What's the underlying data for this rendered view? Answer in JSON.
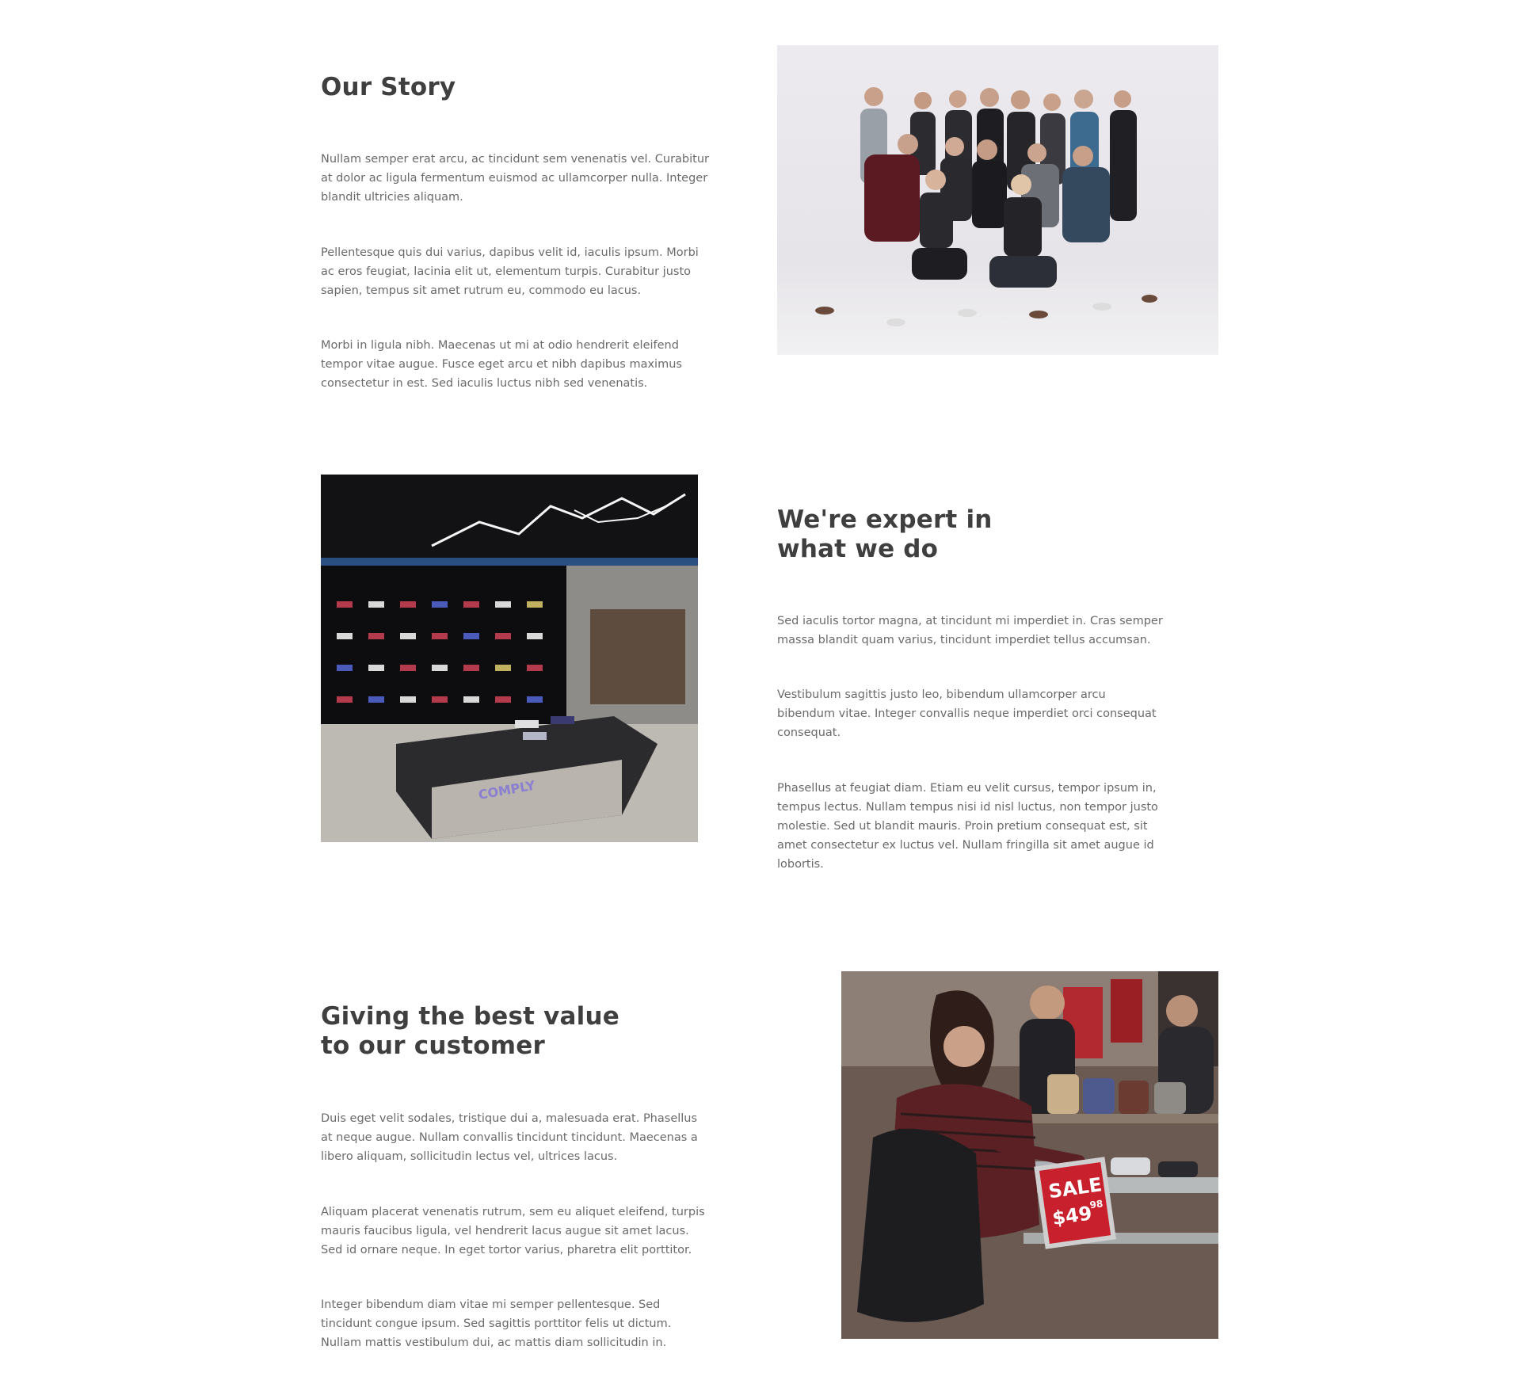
{
  "sections": [
    {
      "title": "Our Story",
      "paragraphs": [
        "Nullam semper erat arcu, ac tincidunt sem venenatis vel. Curabitur at dolor ac ligula fermentum euismod ac ullamcorper nulla. Integer blandit ultricies aliquam.",
        "Pellentesque quis dui varius, dapibus velit id, iaculis ipsum. Morbi ac eros feugiat, lacinia elit ut, elementum turpis. Curabitur justo sapien, tempus sit amet rutrum eu, commodo eu lacus.",
        "Morbi in ligula nibh. Maecenas ut mi at odio hendrerit eleifend tempor vitae augue. Fusce eget arcu et nibh dapibus maximus consectetur in est. Sed iaculis luctus nibh sed venenatis."
      ]
    },
    {
      "title": "We're expert in\nwhat we do",
      "paragraphs": [
        "Sed iaculis tortor magna, at tincidunt mi imperdiet in. Cras semper massa blandit quam varius, tincidunt imperdiet tellus accumsan.",
        "Vestibulum sagittis justo leo, bibendum ullamcorper arcu bibendum vitae. Integer convallis neque imperdiet orci consequat consequat.",
        "Phasellus at feugiat diam. Etiam eu velit cursus, tempor ipsum in, tempus lectus. Nullam tempus nisi id nisl luctus, non tempor justo molestie. Sed ut blandit mauris. Proin pretium consequat est, sit amet consectetur ex luctus vel. Nullam fringilla sit amet augue id lobortis."
      ]
    },
    {
      "title": "Giving the best value\nto our customer",
      "paragraphs": [
        "Duis eget velit sodales, tristique dui a, malesuada erat. Phasellus at neque augue. Nullam convallis tincidunt tincidunt. Maecenas a libero aliquam, sollicitudin lectus vel, ultrices lacus.",
        "Aliquam placerat venenatis rutrum, sem eu aliquet eleifend, turpis mauris faucibus ligula, vel hendrerit lacus augue sit amet lacus. Sed id ornare neque. In eget tortor varius, pharetra elit porttitor.",
        "Integer bibendum diam vitae mi semper pellentesque. Sed tincidunt congue ipsum. Sed sagittis porttitor felis ut dictum. Nullam mattis vestibulum dui, ac mattis diam sollicitudin in."
      ]
    }
  ],
  "images": {
    "team": {
      "icon": "team-photo"
    },
    "store": {
      "icon": "store-interior-photo",
      "sign_text": "COMPLY"
    },
    "shopper": {
      "icon": "shopper-photo",
      "sale_label": "SALE",
      "sale_price": "$49",
      "sale_cents": "98"
    }
  },
  "colors": {
    "heading": "#3f3f3f",
    "body_text": "#6a6a6a",
    "background": "#ffffff",
    "sale_red": "#c8202c"
  }
}
